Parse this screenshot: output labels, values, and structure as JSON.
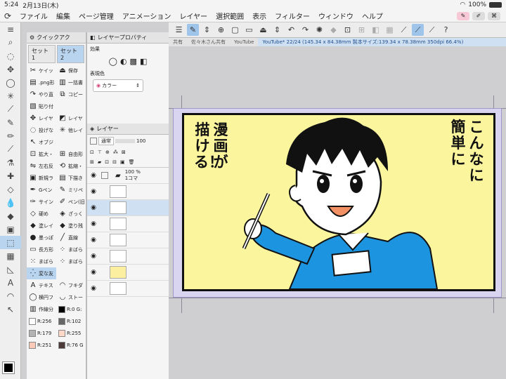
{
  "status": {
    "time": "5:24",
    "date": "2月13日(木)",
    "battery": "100%"
  },
  "menu": {
    "items": [
      "ファイル",
      "編集",
      "ページ管理",
      "アニメーション",
      "レイヤー",
      "選択範囲",
      "表示",
      "フィルター",
      "ウィンドウ",
      "ヘルプ"
    ]
  },
  "tabs": {
    "t1": "共有",
    "t2": "佐々木さん共有",
    "t3": "YouTube",
    "active": "YouTube* 22/24 (145.34 x 84.38mm 製本サイズ:139.34 x 78.38mm 350dpi 66.4%)"
  },
  "quick_access": {
    "title": "クイックアク",
    "set1": "セット1",
    "set2": "セット2",
    "items": [
      "ケイッ",
      "保存",
      ".png形",
      "一括書",
      "やり直",
      "コピー",
      "貼り付",
      "",
      "レイヤ",
      "レイヤ",
      "投げな",
      "他レイ",
      "オブジ",
      "",
      "拡大・",
      "自由形",
      "左右反",
      "拡縮・",
      "新規ラ",
      "下描き",
      "Gペン",
      "ミリペ",
      "サイン",
      "ペン(旧",
      "硬め",
      "ざっく",
      "塗レイ",
      "塗り残",
      "墨っぽ",
      "直線",
      "長方形",
      "まばら",
      "まばら",
      "まばら",
      "変な友",
      "",
      "テキス",
      "フキダ",
      "横円フ",
      "ストー",
      "作線分",
      "R:0 G:",
      "R:256",
      "R:102",
      "R:179",
      "R:255",
      "R:251",
      "R:76 G"
    ]
  },
  "layer_prop": {
    "title": "レイヤープロパティ",
    "effect": "効果",
    "color_label": "表現色",
    "color_value": "カラー"
  },
  "layer_panel": {
    "title": "レイヤー",
    "blend": "通常",
    "opacity": "100",
    "folder_opacity": "100 %",
    "folder_name": "1コマ"
  },
  "manga": {
    "right_col1": "こんなに",
    "right_col2": "簡単に",
    "left_col1": "漫画が",
    "left_col2": "描ける！"
  },
  "colors": {
    "panel_bg": "#fbf59e",
    "shirt": "#1d94e0",
    "selection": "#b9d4ef"
  }
}
